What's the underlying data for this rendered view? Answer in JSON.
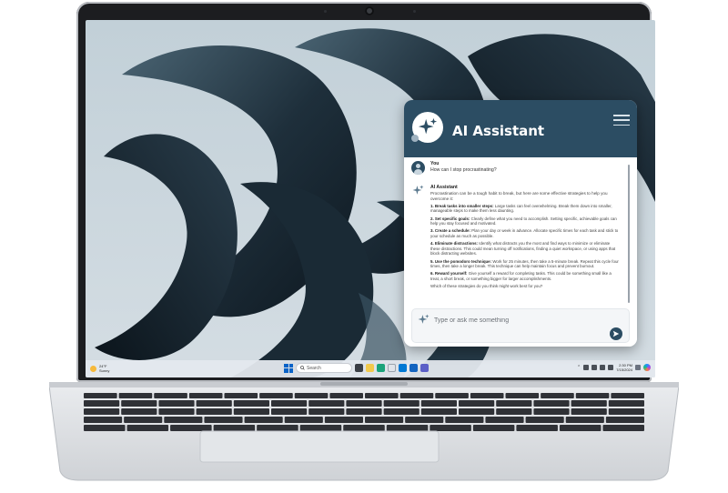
{
  "assistant": {
    "title": "AI Assistant",
    "user_name": "You",
    "user_message": "How can I stop procrastinating?",
    "bot_name": "AI Assistant",
    "intro": "Procrastination can be a tough habit to break, but here are some effective strategies to help you overcome it:",
    "steps": [
      {
        "title": "1. Break tasks into smaller steps:",
        "text": "Large tasks can feel overwhelming. Break them down into smaller, manageable steps to make them less daunting."
      },
      {
        "title": "2. Set specific goals:",
        "text": "Clearly define what you need to accomplish. Setting specific, achievable goals can help you stay focused and motivated."
      },
      {
        "title": "3. Create a schedule:",
        "text": "Plan your day or week in advance. Allocate specific times for each task and stick to your schedule as much as possible."
      },
      {
        "title": "4. Eliminate distractions:",
        "text": "Identify what distracts you the most and find ways to minimize or eliminate these distractions. This could mean turning off notifications, finding a quiet workspace, or using apps that block distracting websites."
      },
      {
        "title": "5. Use the pomodoro technique:",
        "text": "Work for 25 minutes, then take a 5-minute break. Repeat this cycle four times, then take a longer break. This technique can help maintain focus and prevent burnout."
      },
      {
        "title": "6. Reward yourself:",
        "text": "Give yourself a reward for completing tasks. This could be something small like a treat, a short break, or something bigger for larger accomplishments."
      }
    ],
    "closing": "Which of these strategies do you think might work best for you?",
    "input_placeholder": "Type or ask me something"
  },
  "taskbar": {
    "weather_temp": "24°F",
    "weather_desc": "Sunny",
    "search_label": "Search",
    "time": "2:30 PM",
    "date": "7/15/2024"
  },
  "colors": {
    "header": "#2c4d63",
    "send_button": "#2c4d63",
    "accent_windows": "#0a63c7"
  },
  "icons": [
    "webcam",
    "sparkle-icon",
    "menu-icon",
    "user-avatar-icon",
    "send-icon",
    "windows-start-icon",
    "search-icon",
    "copilot-icon"
  ]
}
